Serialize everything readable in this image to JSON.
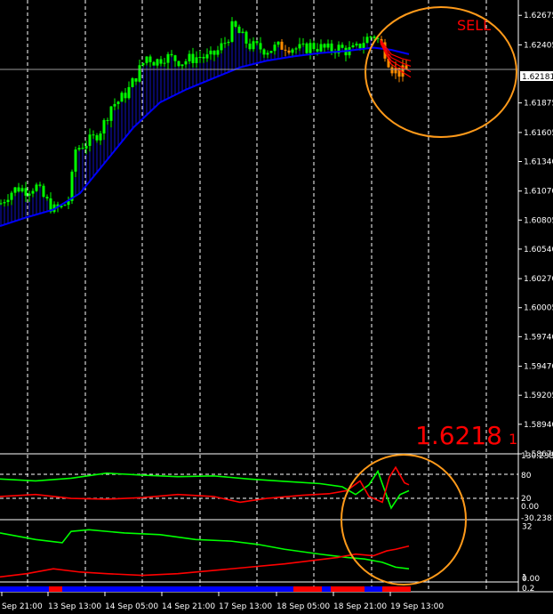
{
  "chart_data": [
    {
      "type": "candlestick",
      "price_axis": {
        "ticks": [
          "1.62675",
          "1.62405",
          "1.62181",
          "1.61875",
          "1.61605",
          "1.61340",
          "1.61070",
          "1.60805",
          "1.60540",
          "1.60270",
          "1.60005",
          "1.59740",
          "1.59470",
          "1.59205",
          "1.58940",
          "1.58670"
        ],
        "min": 1.5867,
        "max": 1.6275
      },
      "time_axis": {
        "labels": [
          "Sep 21:00",
          "13 Sep 13:00",
          "14 Sep 05:00",
          "14 Sep 21:00",
          "17 Sep 13:00",
          "18 Sep 05:00",
          "18 Sep 21:00",
          "19 Sep 13:00"
        ]
      },
      "current_price_tag": "1.62181",
      "big_price": "1.6218",
      "big_price_suffix": "1",
      "annotation": "SELL",
      "colors": {
        "bull": "#00ff00",
        "bear": "#ff8c00",
        "ma": "#0000ff",
        "ma_fill": "#1010c0",
        "signal": "#ff0000",
        "circle": "#ff9a1a",
        "grid": "#ffffff"
      },
      "close_points": [
        [
          0,
          1.6095
        ],
        [
          10,
          1.6105
        ],
        [
          20,
          1.611
        ],
        [
          30,
          1.6108
        ],
        [
          40,
          1.6112
        ],
        [
          50,
          1.61
        ],
        [
          60,
          1.609
        ],
        [
          70,
          1.6092
        ],
        [
          78,
          1.61
        ],
        [
          85,
          1.6145
        ],
        [
          95,
          1.615
        ],
        [
          105,
          1.6155
        ],
        [
          115,
          1.6165
        ],
        [
          125,
          1.6185
        ],
        [
          135,
          1.619
        ],
        [
          145,
          1.62
        ],
        [
          155,
          1.6215
        ],
        [
          165,
          1.623
        ],
        [
          175,
          1.6225
        ],
        [
          185,
          1.623
        ],
        [
          195,
          1.6228
        ],
        [
          205,
          1.6225
        ],
        [
          215,
          1.6228
        ],
        [
          225,
          1.623
        ],
        [
          235,
          1.6228
        ],
        [
          245,
          1.6235
        ],
        [
          255,
          1.6245
        ],
        [
          262,
          1.6258
        ],
        [
          270,
          1.625
        ],
        [
          280,
          1.624
        ],
        [
          290,
          1.6238
        ],
        [
          300,
          1.6236
        ],
        [
          310,
          1.6238
        ],
        [
          320,
          1.624
        ],
        [
          330,
          1.6238
        ],
        [
          340,
          1.6236
        ],
        [
          350,
          1.624
        ],
        [
          360,
          1.6238
        ],
        [
          370,
          1.6236
        ],
        [
          380,
          1.6238
        ],
        [
          390,
          1.6235
        ],
        [
          400,
          1.6236
        ],
        [
          410,
          1.6245
        ],
        [
          420,
          1.625
        ],
        [
          430,
          1.624
        ],
        [
          440,
          1.622
        ],
        [
          450,
          1.6215
        ],
        [
          460,
          1.6218
        ]
      ],
      "ma_points": [
        [
          0,
          1.6075
        ],
        [
          30,
          1.6083
        ],
        [
          60,
          1.609
        ],
        [
          90,
          1.6105
        ],
        [
          120,
          1.6135
        ],
        [
          150,
          1.6165
        ],
        [
          180,
          1.6188
        ],
        [
          210,
          1.62
        ],
        [
          240,
          1.621
        ],
        [
          270,
          1.622
        ],
        [
          300,
          1.6226
        ],
        [
          330,
          1.623
        ],
        [
          360,
          1.6233
        ],
        [
          390,
          1.6235
        ],
        [
          420,
          1.6238
        ],
        [
          440,
          1.6236
        ],
        [
          460,
          1.6232
        ]
      ]
    },
    {
      "type": "line",
      "name": "indicator-1",
      "scale_labels": [
        "130.2381",
        "80",
        "20",
        "0.00",
        "-30.2381"
      ],
      "series": [
        {
          "color": "#00ff00",
          "points": [
            [
              0,
              70
            ],
            [
              40,
              65
            ],
            [
              80,
              72
            ],
            [
              120,
              85
            ],
            [
              160,
              80
            ],
            [
              200,
              76
            ],
            [
              240,
              78
            ],
            [
              280,
              70
            ],
            [
              320,
              64
            ],
            [
              360,
              58
            ],
            [
              385,
              50
            ],
            [
              400,
              30
            ],
            [
              415,
              55
            ],
            [
              425,
              90
            ],
            [
              432,
              45
            ],
            [
              440,
              -5
            ],
            [
              450,
              30
            ],
            [
              460,
              40
            ]
          ]
        },
        {
          "color": "#ff0000",
          "points": [
            [
              0,
              25
            ],
            [
              40,
              30
            ],
            [
              80,
              20
            ],
            [
              120,
              18
            ],
            [
              160,
              22
            ],
            [
              200,
              30
            ],
            [
              240,
              25
            ],
            [
              270,
              10
            ],
            [
              300,
              20
            ],
            [
              340,
              28
            ],
            [
              370,
              32
            ],
            [
              390,
              40
            ],
            [
              405,
              65
            ],
            [
              415,
              25
            ],
            [
              430,
              10
            ],
            [
              438,
              75
            ],
            [
              445,
              100
            ],
            [
              455,
              60
            ],
            [
              460,
              55
            ]
          ]
        }
      ]
    },
    {
      "type": "line",
      "name": "indicator-2",
      "scale_labels": [
        "32",
        "1",
        "0.00"
      ],
      "series": [
        {
          "color": "#00ff00",
          "points": [
            [
              0,
              28
            ],
            [
              40,
              24
            ],
            [
              70,
              22
            ],
            [
              80,
              29
            ],
            [
              100,
              30
            ],
            [
              140,
              28
            ],
            [
              180,
              27
            ],
            [
              220,
              24
            ],
            [
              260,
              23
            ],
            [
              290,
              21
            ],
            [
              320,
              18
            ],
            [
              360,
              15
            ],
            [
              390,
              13
            ],
            [
              410,
              12
            ],
            [
              430,
              10
            ],
            [
              445,
              7
            ],
            [
              460,
              6
            ]
          ]
        },
        {
          "color": "#ff0000",
          "points": [
            [
              0,
              1
            ],
            [
              30,
              3
            ],
            [
              60,
              6
            ],
            [
              90,
              4
            ],
            [
              120,
              3
            ],
            [
              160,
              2
            ],
            [
              200,
              3
            ],
            [
              240,
              5
            ],
            [
              280,
              7
            ],
            [
              320,
              9
            ],
            [
              350,
              11
            ],
            [
              380,
              13
            ],
            [
              400,
              15
            ],
            [
              420,
              14
            ],
            [
              435,
              17
            ],
            [
              445,
              18
            ],
            [
              460,
              20
            ]
          ]
        }
      ]
    },
    {
      "type": "bar",
      "name": "trend-strip",
      "scale_label": "0.2",
      "segments": [
        {
          "color": "#0000ff",
          "from": 0,
          "to": 55
        },
        {
          "color": "#ff0000",
          "from": 55,
          "to": 70
        },
        {
          "color": "#0000ff",
          "from": 70,
          "to": 330
        },
        {
          "color": "#ff0000",
          "from": 330,
          "to": 362
        },
        {
          "color": "#0000ff",
          "from": 362,
          "to": 372
        },
        {
          "color": "#ff0000",
          "from": 372,
          "to": 410
        },
        {
          "color": "#0000ff",
          "from": 410,
          "to": 430
        },
        {
          "color": "#ff0000",
          "from": 430,
          "to": 462
        }
      ]
    }
  ]
}
